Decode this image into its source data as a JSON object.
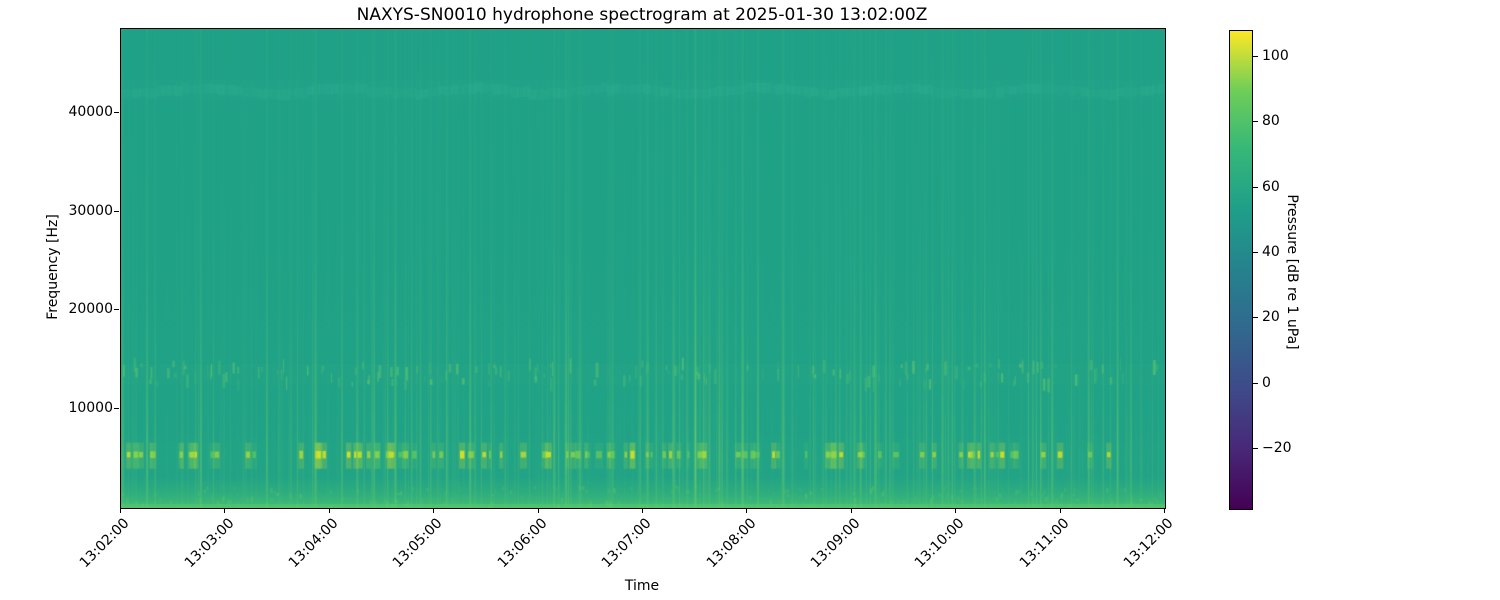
{
  "figure": {
    "title": "NAXYS-SN0010 hydrophone spectrogram at 2025-01-30 13:02:00Z"
  },
  "axes": {
    "xlabel": "Time",
    "ylabel": "Frequency [Hz]",
    "x_tick_labels": [
      "13:02:00",
      "13:03:00",
      "13:04:00",
      "13:05:00",
      "13:06:00",
      "13:07:00",
      "13:08:00",
      "13:09:00",
      "13:10:00",
      "13:11:00",
      "13:12:00"
    ],
    "y_tick_labels": [
      "10000",
      "20000",
      "30000",
      "40000"
    ],
    "y_tick_values": [
      10000,
      20000,
      30000,
      40000
    ]
  },
  "colorbar": {
    "label": "Pressure [dB re 1 uPa]",
    "tick_labels": [
      "100",
      "80",
      "60",
      "40",
      "20",
      "0",
      "−20"
    ],
    "tick_values": [
      100,
      80,
      60,
      40,
      20,
      0,
      -20
    ],
    "range_db": [
      -39,
      108
    ],
    "colormap": "viridis"
  },
  "chart_data": {
    "type": "heatmap",
    "subtype": "spectrogram",
    "title": "NAXYS-SN0010 hydrophone spectrogram at 2025-01-30 13:02:00Z",
    "xlabel": "Time",
    "ylabel": "Frequency [Hz]",
    "x_ticks": [
      "13:02:00",
      "13:03:00",
      "13:04:00",
      "13:05:00",
      "13:06:00",
      "13:07:00",
      "13:08:00",
      "13:09:00",
      "13:10:00",
      "13:11:00",
      "13:12:00"
    ],
    "x_range_time": [
      "13:02:00",
      "13:12:00"
    ],
    "y_ticks_hz": [
      10000,
      20000,
      30000,
      40000
    ],
    "y_range_hz": [
      0,
      48500
    ],
    "value_axis": {
      "label": "Pressure [dB re 1 uPa]",
      "ticks": [
        100,
        80,
        60,
        40,
        20,
        0,
        -20
      ],
      "range": [
        -39,
        108
      ]
    },
    "colormap": "viridis",
    "grid": false,
    "legend": false,
    "background_level_db": 52,
    "features": {
      "broadband_transients": {
        "count": 300,
        "description": "faint vertical green streaks at random times, stronger below ~15 kHz",
        "seed": 7
      },
      "tonal_band": {
        "center_hz": 42300,
        "halfwidth_hz": 500,
        "description": "faint wavy slightly-lighter horizontal band"
      },
      "click_band": {
        "center_hz": 13500,
        "halfwidth_hz": 1100,
        "dash_count": 160,
        "description": "band of short brighter dashes"
      },
      "ping_band": {
        "center_hz": 5500,
        "halfwidth_hz": 350,
        "ping_count": 95,
        "description": "row of bright yellow-green impulsive pings"
      },
      "low_freq_band": {
        "max_hz": 2300,
        "description": "elevated broadband level, brightest at 0 Hz edge"
      }
    }
  },
  "colors": {
    "plot_background": "#1fa187",
    "streak_green": "#5ec962",
    "ping_bright": "#d8e219",
    "low_band_green": "#4ac16d",
    "tonal_band_teal": "#2fb496",
    "viridis_stops": [
      "#440154",
      "#482878",
      "#3e4a89",
      "#31688e",
      "#26828e",
      "#1f9e89",
      "#35b779",
      "#6ece58",
      "#fde725"
    ]
  },
  "icons": {}
}
